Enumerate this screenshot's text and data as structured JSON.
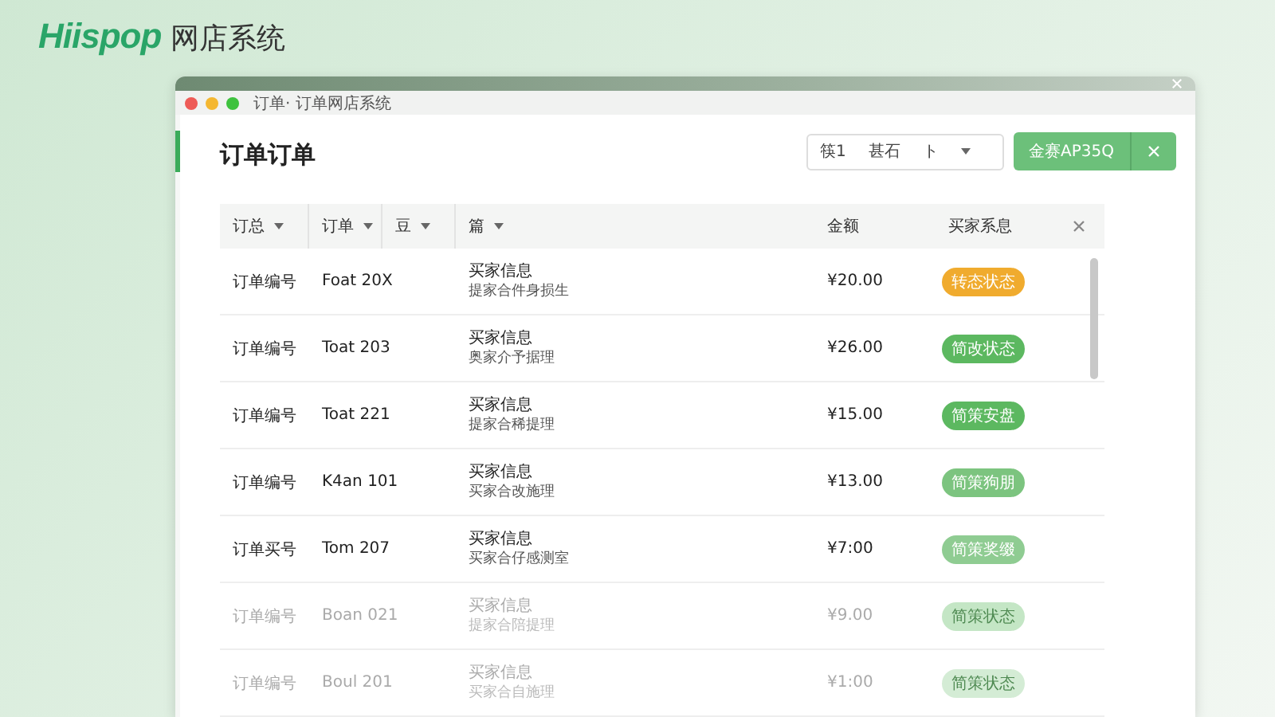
{
  "brand": {
    "logo": "Hiispop",
    "name": "网店系统"
  },
  "window": {
    "title": "订单·  订单网店系统"
  },
  "page": {
    "title": "订单订单"
  },
  "filter": {
    "parts": [
      "筷1",
      "甚石",
      "ト"
    ]
  },
  "action_button": {
    "label": "金赛AP35Q"
  },
  "table": {
    "columns": [
      {
        "label": "订总",
        "sortable": true
      },
      {
        "label": "订单",
        "sortable": true
      },
      {
        "label": "豆",
        "sortable": true
      },
      {
        "label": "篇",
        "sortable": true
      },
      {
        "label": "金额",
        "sortable": false
      },
      {
        "label": "买家系息",
        "sortable": false
      }
    ],
    "rows": [
      {
        "order": "订单编号",
        "name": "Foat 20X",
        "info": "买家信息",
        "detail": "提家合件身损生",
        "amount": "¥20.00",
        "status": "转态状态",
        "color": "#f0ab2e",
        "faded": false
      },
      {
        "order": "订单编号",
        "name": "Toat 203",
        "info": "买家信息",
        "detail": "奥家介予据理",
        "amount": "¥26.00",
        "status": "简改状态",
        "color": "#5cb860",
        "faded": false
      },
      {
        "order": "订单编号",
        "name": "Toat 221",
        "info": "买家信息",
        "detail": "提家合稀提理",
        "amount": "¥15.00",
        "status": "简策安盘",
        "color": "#5cb860",
        "faded": false
      },
      {
        "order": "订单编号",
        "name": "K4an 101",
        "info": "买家信息",
        "detail": "买家合改施理",
        "amount": "¥13.00",
        "status": "简策狗朋",
        "color": "#7cc47f",
        "faded": false
      },
      {
        "order": "订单买号",
        "name": "Tom 207",
        "info": "买家信息",
        "detail": "买家合仔感测室",
        "amount": "¥7:00",
        "status": "简策奖缀",
        "color": "#8fcc92",
        "faded": false
      },
      {
        "order": "订单编号",
        "name": "Boan 021",
        "info": "买家信息",
        "detail": "提家合陪提理",
        "amount": "¥9.00",
        "status": "简策状态",
        "color": "#c4e6c5",
        "faded": true
      },
      {
        "order": "订单编号",
        "name": "Boul 201",
        "info": "买家信息",
        "detail": "买家合自施理",
        "amount": "¥1:00",
        "status": "简策状态",
        "color": "#d4ecd5",
        "faded": true
      }
    ]
  }
}
